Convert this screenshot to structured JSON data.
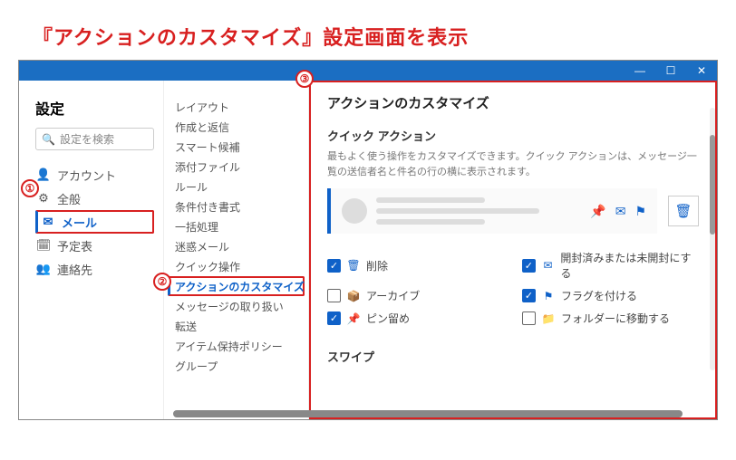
{
  "annotation_title": "『アクションのカスタマイズ』設定画面を表示",
  "badges": {
    "one": "①",
    "two": "②",
    "three": "③"
  },
  "sidebar": {
    "title": "設定",
    "search_placeholder": "設定を検索",
    "items": [
      {
        "icon": "👤",
        "label": "アカウント"
      },
      {
        "icon": "⚙",
        "label": "全般"
      },
      {
        "icon": "✉",
        "label": "メール",
        "selected": true
      },
      {
        "icon": "🗓",
        "label": "予定表"
      },
      {
        "icon": "👥",
        "label": "連絡先"
      }
    ]
  },
  "mid_nav": [
    "レイアウト",
    "作成と返信",
    "スマート候補",
    "添付ファイル",
    "ルール",
    "条件付き書式",
    "一括処理",
    "迷惑メール",
    "クイック操作",
    "アクションのカスタマイズ",
    "メッセージの取り扱い",
    "転送",
    "アイテム保持ポリシー",
    "グループ"
  ],
  "mid_selected_index": 9,
  "panel": {
    "title": "アクションのカスタマイズ",
    "section1_title": "クイック アクション",
    "section1_desc": "最もよく使う操作をカスタマイズできます。クイック アクションは、メッセージ一覧の送信者名と件名の行の横に表示されます。",
    "checkboxes": [
      {
        "checked": true,
        "icon": "🗑",
        "label": "削除"
      },
      {
        "checked": true,
        "icon": "✉",
        "label": "開封済みまたは未開封にする"
      },
      {
        "checked": false,
        "icon": "📦",
        "label": "アーカイブ"
      },
      {
        "checked": true,
        "icon": "⚑",
        "label": "フラグを付ける"
      },
      {
        "checked": true,
        "icon": "📌",
        "label": "ピン留め"
      },
      {
        "checked": false,
        "icon": "📁",
        "label": "フォルダーに移動する"
      }
    ],
    "section2_title": "スワイプ"
  }
}
